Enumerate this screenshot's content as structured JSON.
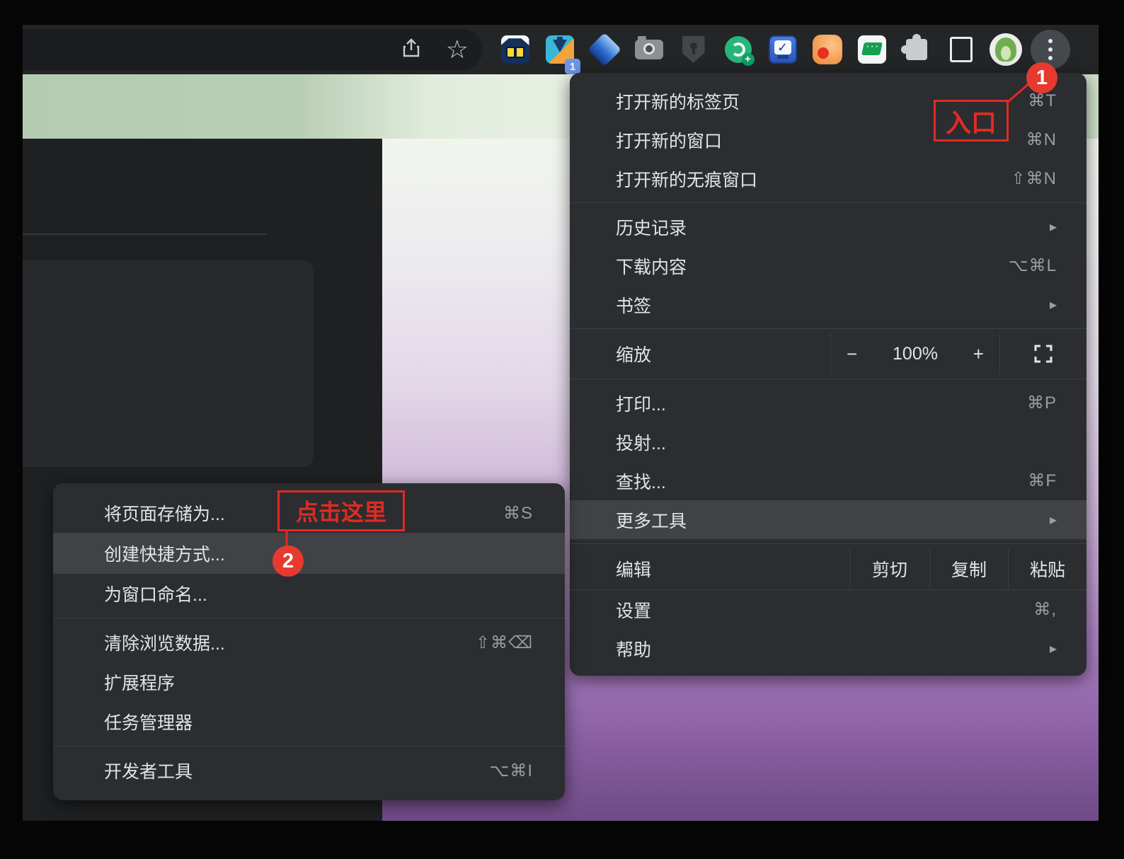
{
  "toolbar": {
    "address_icons": [
      {
        "name": "share-icon"
      },
      {
        "name": "bookmark-star-icon"
      }
    ],
    "extensions": [
      {
        "name": "cat-extension-icon"
      },
      {
        "name": "downloads-extension-icon",
        "badge": "1"
      },
      {
        "name": "gem-extension-icon"
      },
      {
        "name": "camera-extension-icon"
      },
      {
        "name": "shield-extension-icon"
      },
      {
        "name": "green-snail-extension-icon"
      },
      {
        "name": "checkbox-extension-icon"
      },
      {
        "name": "orange-reader-extension-icon"
      },
      {
        "name": "chat-extension-icon"
      },
      {
        "name": "extensions-puzzle-icon"
      },
      {
        "name": "side-panel-icon"
      },
      {
        "name": "profile-avatar"
      },
      {
        "name": "three-dot-menu-button"
      }
    ]
  },
  "main_menu": {
    "items": [
      {
        "label": "打开新的标签页",
        "shortcut": "⌘T"
      },
      {
        "label": "打开新的窗口",
        "shortcut": "⌘N"
      },
      {
        "label": "打开新的无痕窗口",
        "shortcut": "⇧⌘N"
      },
      {
        "label": "历史记录",
        "arrow": "▸"
      },
      {
        "label": "下载内容",
        "shortcut": "⌥⌘L"
      },
      {
        "label": "书签",
        "arrow": "▸"
      },
      {
        "label": "打印...",
        "shortcut": "⌘P"
      },
      {
        "label": "投射..."
      },
      {
        "label": "查找...",
        "shortcut": "⌘F"
      },
      {
        "label": "更多工具",
        "arrow": "▸",
        "highlighted": true
      },
      {
        "label": "设置",
        "shortcut": "⌘,"
      },
      {
        "label": "帮助",
        "arrow": "▸"
      }
    ],
    "zoom_row": {
      "label": "缩放",
      "minus": "−",
      "value": "100%",
      "plus": "+"
    },
    "edit_row": {
      "label": "编辑",
      "cut": "剪切",
      "copy": "复制",
      "paste": "粘贴"
    }
  },
  "submenu": {
    "items": [
      {
        "label": "将页面存储为...",
        "shortcut": "⌘S"
      },
      {
        "label": "创建快捷方式...",
        "highlighted": true
      },
      {
        "label": "为窗口命名..."
      },
      {
        "label": "清除浏览数据...",
        "shortcut": "⇧⌘⌫"
      },
      {
        "label": "扩展程序"
      },
      {
        "label": "任务管理器"
      },
      {
        "label": "开发者工具",
        "shortcut": "⌥⌘I"
      }
    ]
  },
  "annotations": {
    "entry": {
      "label": "入口",
      "badge": "1"
    },
    "click_here": {
      "label": "点击这里",
      "badge": "2"
    }
  },
  "colors": {
    "annotation_red": "#e02b22",
    "badge_red": "#e63a30",
    "menu_background": "#2b2d30",
    "menu_highlight": "#404245",
    "toolbar_background": "#232527",
    "header_green": "#b7cdb3",
    "gradient_purple": "#8a5fa3",
    "downloads_badge_blue": "#6e96e9"
  }
}
